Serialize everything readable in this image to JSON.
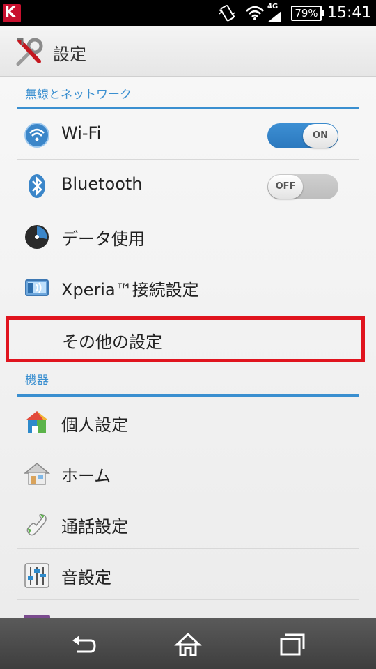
{
  "status_bar": {
    "network": "4G",
    "battery": "79%",
    "time": "15:41"
  },
  "action_bar": {
    "title": "設定"
  },
  "sections": [
    {
      "header": "無線とネットワーク",
      "items": [
        {
          "label": "Wi-Fi",
          "icon": "wifi-icon",
          "toggle": "ON"
        },
        {
          "label": "Bluetooth",
          "icon": "bluetooth-icon",
          "toggle": "OFF"
        },
        {
          "label": "データ使用",
          "icon": "data-usage-icon"
        },
        {
          "label": "Xperia™接続設定",
          "icon": "xperia-connect-icon"
        },
        {
          "label": "その他の設定",
          "icon": "",
          "highlighted": true
        }
      ]
    },
    {
      "header": "機器",
      "items": [
        {
          "label": "個人設定",
          "icon": "personalization-icon"
        },
        {
          "label": "ホーム",
          "icon": "home-icon"
        },
        {
          "label": "通話設定",
          "icon": "phone-icon"
        },
        {
          "label": "音設定",
          "icon": "sound-sliders-icon"
        }
      ]
    }
  ],
  "colors": {
    "accent": "#3a8fd0",
    "highlight_border": "#e0141e",
    "toggle_on": "#2f80c6"
  }
}
